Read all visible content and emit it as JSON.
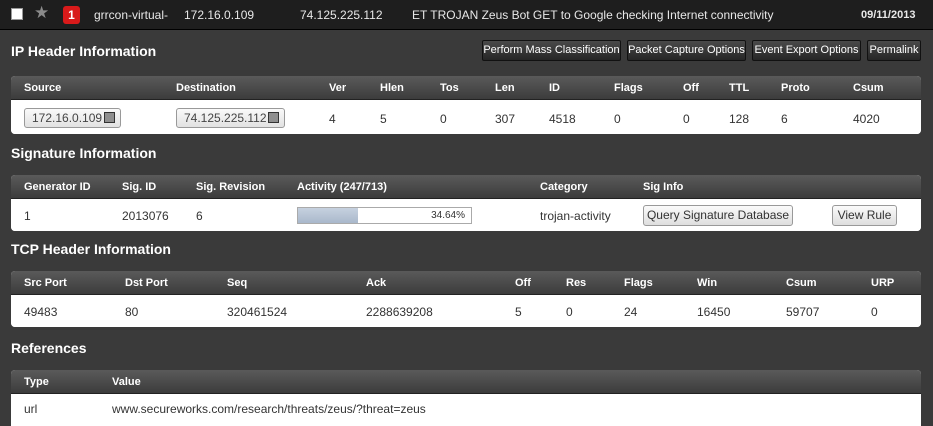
{
  "event": {
    "priority": "1",
    "sensor": "grrcon-virtual-",
    "src_ip": "172.16.0.109",
    "dst_ip": "74.125.225.112",
    "signature": "ET TROJAN Zeus Bot GET to Google checking Internet connectivity",
    "date": "09/11/2013",
    "icons": {
      "select": "checkbox-icon",
      "favorite": "star-icon"
    }
  },
  "ip_header": {
    "title": "IP Header Information",
    "buttons": {
      "mass_classification": "Perform Mass Classification",
      "packet_capture": "Packet Capture Options",
      "event_export": "Event Export Options",
      "permalink": "Permalink"
    },
    "columns": [
      "Source",
      "Destination",
      "Ver",
      "Hlen",
      "Tos",
      "Len",
      "ID",
      "Flags",
      "Off",
      "TTL",
      "Proto",
      "Csum"
    ],
    "values": {
      "source": "172.16.0.109",
      "destination": "74.125.225.112",
      "ver": "4",
      "hlen": "5",
      "tos": "0",
      "len": "307",
      "id": "4518",
      "flags": "0",
      "off": "0",
      "ttl": "128",
      "proto": "6",
      "csum": "4020"
    }
  },
  "signature": {
    "title": "Signature Information",
    "columns": [
      "Generator ID",
      "Sig. ID",
      "Sig. Revision",
      "Activity (247/713)",
      "Category",
      "Sig Info"
    ],
    "values": {
      "generator_id": "1",
      "sig_id": "2013076",
      "revision": "6",
      "activity_pct": "34.64%",
      "activity_fraction": 0.3464,
      "category": "trojan-activity"
    },
    "buttons": {
      "query": "Query Signature Database",
      "view_rule": "View Rule"
    }
  },
  "tcp_header": {
    "title": "TCP Header Information",
    "columns": [
      "Src Port",
      "Dst Port",
      "Seq",
      "Ack",
      "Off",
      "Res",
      "Flags",
      "Win",
      "Csum",
      "URP"
    ],
    "values": [
      "49483",
      "80",
      "320461524",
      "2288639208",
      "5",
      "0",
      "24",
      "16450",
      "59707",
      "0"
    ]
  },
  "references": {
    "title": "References",
    "columns": [
      "Type",
      "Value"
    ],
    "rows": [
      {
        "type": "url",
        "value": "www.secureworks.com/research/threats/zeus/?threat=zeus"
      }
    ]
  },
  "colors": {
    "background": "#3a3a3a",
    "topbar": "#1e1e1e",
    "priority_badge": "#d81a1a",
    "progress_fill": "#b7c4d5"
  }
}
